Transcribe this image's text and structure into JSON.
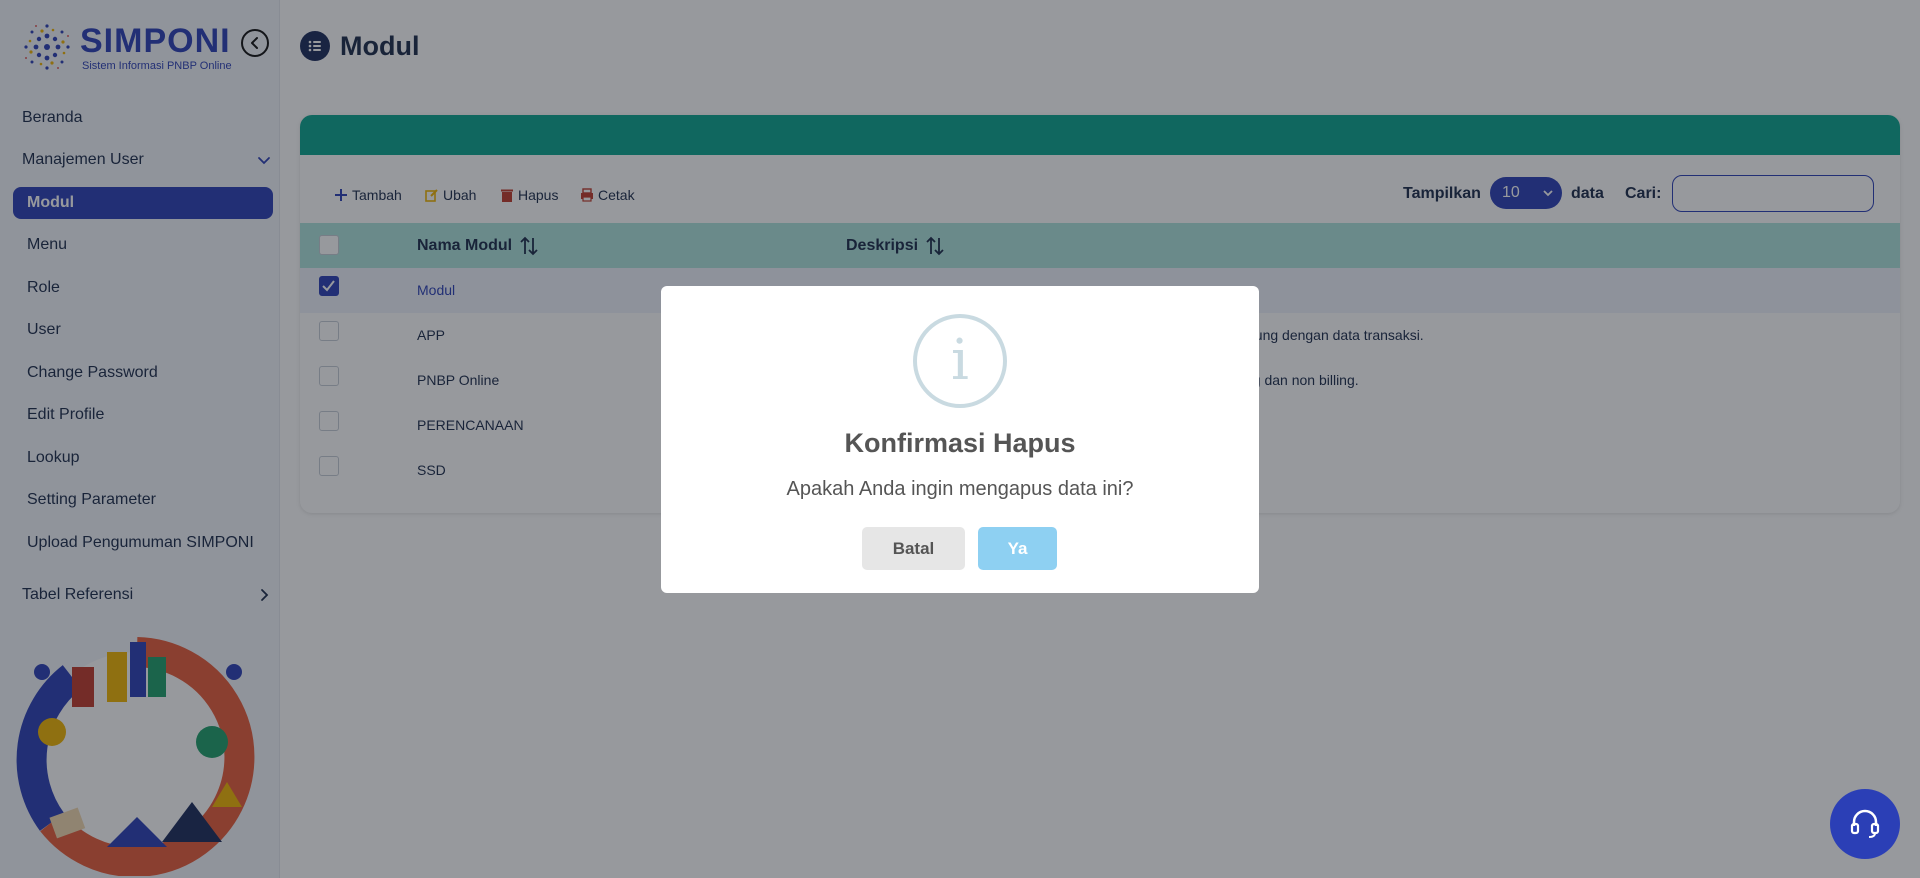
{
  "brand": {
    "name": "SIMPONI",
    "subtitle": "Sistem Informasi PNBP Online"
  },
  "sidebar": {
    "items": [
      {
        "label": "Beranda"
      },
      {
        "label": "Manajemen User"
      },
      {
        "label": "Modul"
      },
      {
        "label": "Menu"
      },
      {
        "label": "Role"
      },
      {
        "label": "User"
      },
      {
        "label": "Change Password"
      },
      {
        "label": "Edit Profile"
      },
      {
        "label": "Lookup"
      },
      {
        "label": "Setting Parameter"
      },
      {
        "label": "Upload Pengumuman SIMPONI"
      },
      {
        "label": "Tabel Referensi"
      }
    ]
  },
  "page": {
    "title": "Modul"
  },
  "toolbar": {
    "add": "Tambah",
    "edit": "Ubah",
    "delete": "Hapus",
    "print": "Cetak",
    "show_label": "Tampilkan",
    "show_value": "10",
    "data_label": "data",
    "search_label": "Cari:",
    "search_value": ""
  },
  "table": {
    "columns": [
      "Nama Modul",
      "Deskripsi"
    ],
    "rows": [
      {
        "name": "Modul",
        "desc": "",
        "checked": true
      },
      {
        "name": "APP",
        "desc": "gsung dengan data transaksi.",
        "checked": false
      },
      {
        "name": "PNBP Online",
        "desc": "ng dan non billing.",
        "checked": false
      },
      {
        "name": "PERENCANAAN",
        "desc": "",
        "checked": false
      },
      {
        "name": "SSD",
        "desc": "",
        "checked": false
      }
    ]
  },
  "modal": {
    "icon": "info-icon",
    "title": "Konfirmasi Hapus",
    "message": "Apakah Anda ingin mengapus data ini?",
    "cancel": "Batal",
    "confirm": "Ya"
  },
  "colors": {
    "primary": "#2b3fb6",
    "teal": "#0aa58f",
    "table_header": "#aee3dd",
    "confirm_button": "#8ed0f2"
  }
}
